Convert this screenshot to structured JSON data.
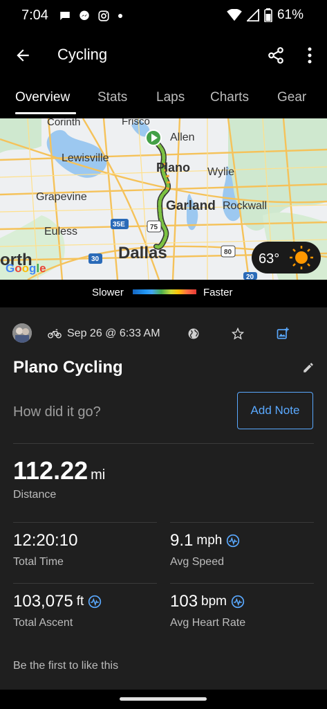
{
  "status_bar": {
    "time": "7:04",
    "battery": "61%",
    "left_icons": [
      "chat-bubble-icon",
      "messenger-icon",
      "instagram-icon",
      "dot-icon"
    ],
    "right_icons": [
      "wifi-icon",
      "cell-signal-icon",
      "battery-icon"
    ]
  },
  "app_bar": {
    "title": "Cycling",
    "icons": [
      "back-arrow-icon",
      "share-icon",
      "more-vert-icon"
    ]
  },
  "tabs": [
    {
      "label": "Overview",
      "active": true
    },
    {
      "label": "Stats",
      "active": false
    },
    {
      "label": "Laps",
      "active": false
    },
    {
      "label": "Charts",
      "active": false
    },
    {
      "label": "Gear",
      "active": false
    }
  ],
  "map": {
    "places": [
      "Frisco",
      "Allen",
      "Lewisville",
      "Plano",
      "Wylie",
      "Grapevine",
      "Garland",
      "Rockwall",
      "Euless",
      "Dallas",
      "orth",
      "Corinth"
    ],
    "highways": [
      "35E",
      "75",
      "80",
      "30",
      "20"
    ],
    "attribution": "Google",
    "weather": {
      "temp": "63°",
      "icon": "sun-icon"
    }
  },
  "speed_legend": {
    "slower": "Slower",
    "faster": "Faster"
  },
  "activity": {
    "date": "Sep 26 @ 6:33 AM",
    "title": "Plano Cycling",
    "note_prompt": "How did it go?",
    "add_note": "Add Note",
    "distance": {
      "value": "112.22",
      "unit": "mi",
      "label": "Distance"
    },
    "total_time": {
      "value": "12:20:10",
      "label": "Total Time"
    },
    "avg_speed": {
      "value": "9.1",
      "unit": "mph",
      "label": "Avg Speed"
    },
    "total_ascent": {
      "value": "103,075",
      "unit": "ft",
      "label": "Total Ascent"
    },
    "avg_hr": {
      "value": "103",
      "unit": "bpm",
      "label": "Avg Heart Rate"
    },
    "likes": "Be the first to like this"
  },
  "colors": {
    "accent_blue": "#5aa9ff",
    "route_green": "#4caf50",
    "start_pin": "#43a047"
  }
}
